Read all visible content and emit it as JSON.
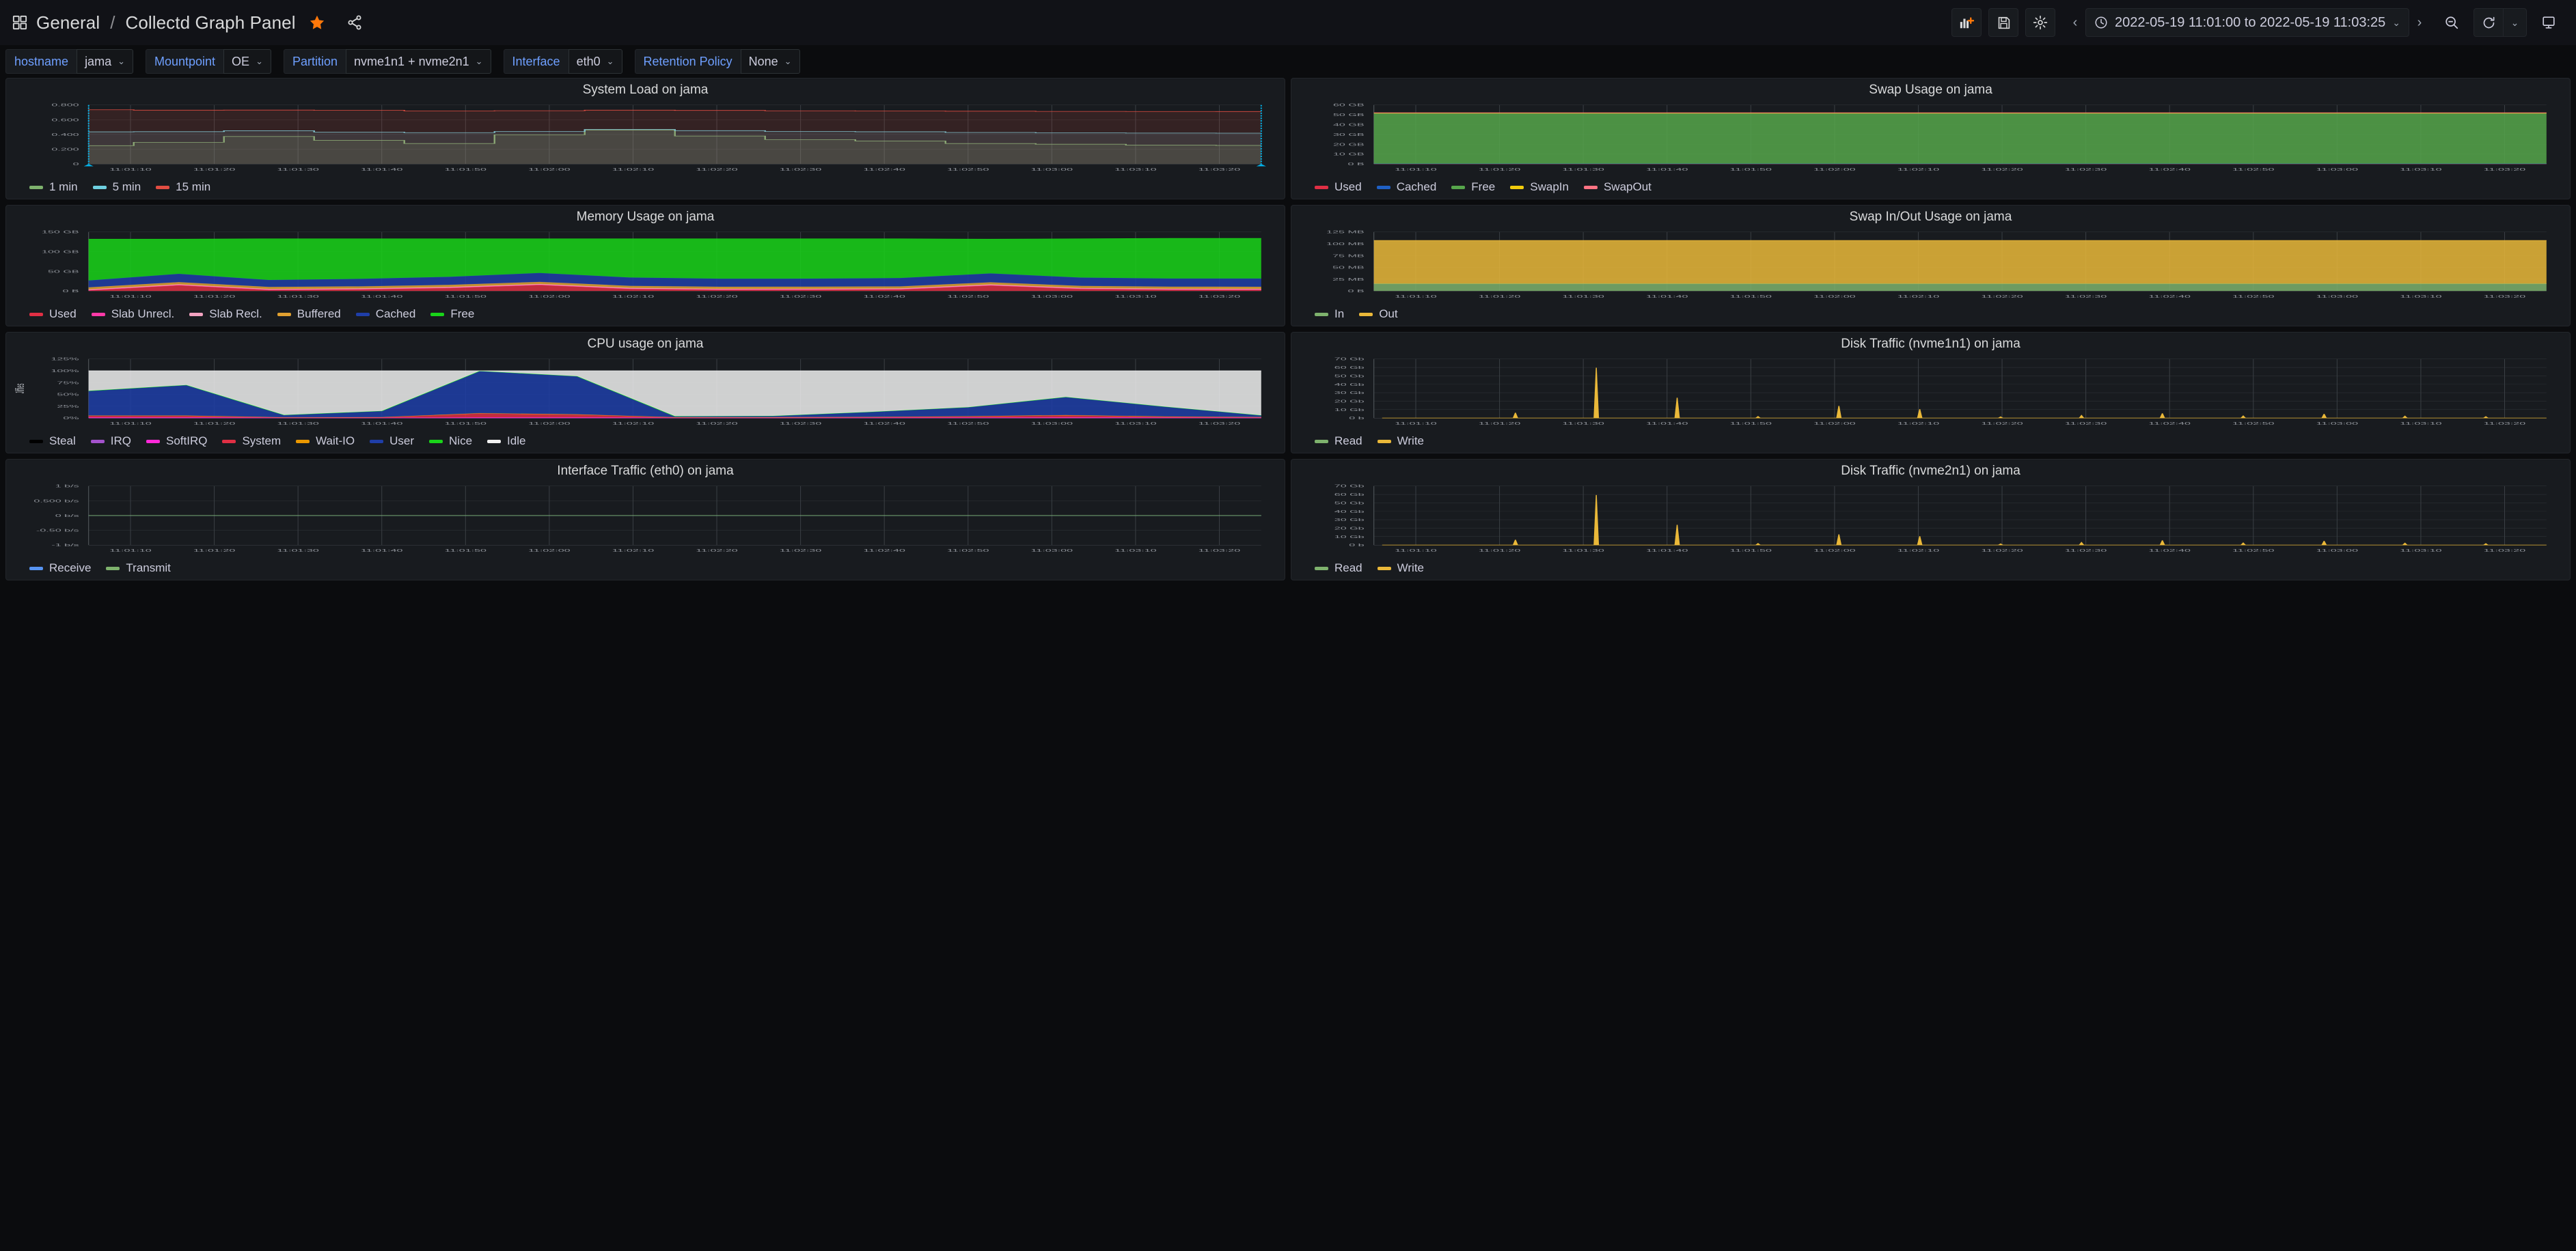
{
  "header": {
    "folder": "General",
    "separator": "/",
    "dashboard_title": "Collectd Graph Panel",
    "grid_icon": "dashboard-grid-icon",
    "star_icon": "star-icon",
    "share_icon": "share-icon",
    "star_color": "#ff780a"
  },
  "toolbar": {
    "add_panel_label": "Add panel",
    "save_label": "Save dashboard",
    "settings_label": "Dashboard settings",
    "prev_label": "Move time range back",
    "next_label": "Move time range forward",
    "time_range": "2022-05-19 11:01:00 to 2022-05-19 11:03:25",
    "zoom_out_label": "Zoom out time range",
    "refresh_label": "Refresh dashboard",
    "refresh_interval": "",
    "tv_label": "Cycle view mode"
  },
  "variables": [
    {
      "label": "hostname",
      "value": "jama"
    },
    {
      "label": "Mountpoint",
      "value": "OE"
    },
    {
      "label": "Partition",
      "value": "nvme1n1 + nvme2n1"
    },
    {
      "label": "Interface",
      "value": "eth0"
    },
    {
      "label": "Retention Policy",
      "value": "None"
    }
  ],
  "colors": {
    "page_bg": "#0b0c0e",
    "panel_bg": "#181b1f",
    "panel_border": "#23262b",
    "text": "#ccccdc",
    "variable_label": "#6e9fff",
    "annotation": "#00b6ef",
    "grid": "#3a3f44"
  },
  "chart_data": [
    {
      "id": "system-load",
      "type": "line",
      "title": "System Load on jama",
      "ylabel": "",
      "xlabel": "",
      "ylim": [
        0,
        0.8
      ],
      "yticks": [
        0,
        0.2,
        0.4,
        0.6,
        0.8
      ],
      "ytick_labels": [
        "0",
        "0.200",
        "0.400",
        "0.600",
        "0.800"
      ],
      "x": [
        "11:01:10",
        "11:01:20",
        "11:01:30",
        "11:01:40",
        "11:01:50",
        "11:02:00",
        "11:02:10",
        "11:02:20",
        "11:02:30",
        "11:02:40",
        "11:02:50",
        "11:03:00",
        "11:03:10",
        "11:03:20"
      ],
      "grid": true,
      "legend_position": "bottom",
      "annotations": [
        {
          "x": "11:01:10",
          "color": "#00b6ef"
        },
        {
          "x": "11:03:20",
          "color": "#00b6ef"
        }
      ],
      "series": [
        {
          "name": "1 min",
          "color": "#7eb26d",
          "values": [
            0.248,
            0.294,
            0.373,
            0.32,
            0.277,
            0.396,
            0.46,
            0.379,
            0.331,
            0.312,
            0.277,
            0.268,
            0.255,
            0.252
          ]
        },
        {
          "name": "5 min",
          "color": "#6ed0e0",
          "values": [
            0.436,
            0.438,
            0.451,
            0.433,
            0.425,
            0.441,
            0.468,
            0.452,
            0.441,
            0.437,
            0.427,
            0.421,
            0.419,
            0.418
          ]
        },
        {
          "name": "15 min",
          "color": "#e24d42",
          "values": [
            0.735,
            0.73,
            0.731,
            0.728,
            0.719,
            0.722,
            0.73,
            0.726,
            0.721,
            0.719,
            0.716,
            0.713,
            0.712,
            0.711
          ]
        }
      ]
    },
    {
      "id": "swap-usage",
      "type": "area",
      "title": "Swap Usage on jama",
      "ylabel": "",
      "xlabel": "",
      "ylim": [
        0,
        60
      ],
      "yunit": "GB",
      "yticks": [
        0,
        10,
        20,
        30,
        40,
        50,
        60
      ],
      "ytick_labels": [
        "0 B",
        "10 GB",
        "20 GB",
        "30 GB",
        "40 GB",
        "50 GB",
        "60 GB"
      ],
      "x": [
        "11:01:10",
        "11:01:20",
        "11:01:30",
        "11:01:40",
        "11:01:50",
        "11:02:00",
        "11:02:10",
        "11:02:20",
        "11:02:30",
        "11:02:40",
        "11:02:50",
        "11:03:00",
        "11:03:10",
        "11:03:20"
      ],
      "grid": true,
      "legend_position": "bottom",
      "series": [
        {
          "name": "Used",
          "color": "#e02f44",
          "values": [
            0.2,
            0.2,
            0.2,
            0.2,
            0.2,
            0.2,
            0.2,
            0.2,
            0.2,
            0.2,
            0.2,
            0.2,
            0.2,
            0.2
          ]
        },
        {
          "name": "Cached",
          "color": "#1f60c4",
          "values": [
            0.1,
            0.1,
            0.1,
            0.1,
            0.1,
            0.1,
            0.1,
            0.1,
            0.1,
            0.1,
            0.1,
            0.1,
            0.1,
            0.1
          ]
        },
        {
          "name": "Free",
          "color": "#56a64b",
          "values": [
            51.4,
            51.4,
            51.4,
            51.4,
            51.4,
            51.4,
            51.4,
            51.4,
            51.4,
            51.4,
            51.4,
            51.4,
            51.4,
            51.4
          ]
        },
        {
          "name": "SwapIn",
          "color": "#f2cc0c",
          "values": [
            0,
            0,
            0,
            0,
            0,
            0,
            0,
            0,
            0,
            0,
            0,
            0,
            0,
            0
          ]
        },
        {
          "name": "SwapOut",
          "color": "#ff7383",
          "values": [
            0.4,
            0.4,
            0.4,
            0.4,
            0.4,
            0.4,
            0.4,
            0.4,
            0.4,
            0.4,
            0.4,
            0.4,
            0.4,
            0.4
          ]
        }
      ]
    },
    {
      "id": "memory-usage",
      "type": "area",
      "title": "Memory Usage on jama",
      "ylabel": "",
      "xlabel": "",
      "ylim": [
        0,
        150
      ],
      "yunit": "GB",
      "yticks": [
        0,
        50,
        100,
        150
      ],
      "ytick_labels": [
        "0 B",
        "50 GB",
        "100 GB",
        "150 GB"
      ],
      "x": [
        "11:01:10",
        "11:01:20",
        "11:01:30",
        "11:01:40",
        "11:01:50",
        "11:02:00",
        "11:02:10",
        "11:02:20",
        "11:02:30",
        "11:02:40",
        "11:02:50",
        "11:03:00",
        "11:03:10",
        "11:03:20"
      ],
      "grid": true,
      "legend_position": "bottom",
      "series": [
        {
          "name": "Used",
          "color": "#e02f44",
          "values": [
            1.5,
            14.5,
            2.6,
            4.0,
            7.7,
            15.2,
            5.3,
            3.1,
            3.3,
            4.0,
            14.0,
            5.2,
            3.3,
            3.0
          ]
        },
        {
          "name": "Slab Unrecl.",
          "color": "#ff3aa8",
          "values": [
            0.8,
            0.8,
            0.8,
            0.8,
            0.8,
            0.8,
            0.8,
            0.8,
            0.8,
            0.8,
            0.8,
            0.8,
            0.8,
            0.8
          ]
        },
        {
          "name": "Slab Recl.",
          "color": "#f2a2c0",
          "values": [
            1.4,
            1.5,
            1.4,
            1.4,
            1.4,
            1.5,
            1.4,
            1.4,
            1.4,
            1.4,
            1.6,
            1.4,
            1.4,
            1.4
          ]
        },
        {
          "name": "Buffered",
          "color": "#e0a030",
          "values": [
            5.4,
            5.5,
            5.4,
            5.4,
            5.4,
            5.5,
            5.4,
            5.4,
            5.4,
            5.4,
            5.5,
            5.4,
            5.4,
            5.4
          ]
        },
        {
          "name": "Cached",
          "color": "#1f3ea8",
          "values": [
            17.5,
            21.3,
            17.8,
            19.2,
            20.8,
            22.8,
            21.4,
            20.5,
            20.5,
            21.4,
            22.7,
            21.2,
            20.8,
            21.0
          ]
        },
        {
          "name": "Free",
          "color": "#19d419",
          "values": [
            105.0,
            88.0,
            104.6,
            101.8,
            96.5,
            86.8,
            98.3,
            101.4,
            101.2,
            99.6,
            87.0,
            98.6,
            101.9,
            102.0
          ]
        }
      ]
    },
    {
      "id": "swap-in-out",
      "type": "area",
      "title": "Swap In/Out Usage on jama",
      "ylabel": "",
      "xlabel": "",
      "ylim": [
        0,
        125
      ],
      "yunit": "MB",
      "yticks": [
        0,
        25,
        50,
        75,
        100,
        125
      ],
      "ytick_labels": [
        "0 B",
        "25 MB",
        "50 MB",
        "75 MB",
        "100 MB",
        "125 MB"
      ],
      "x": [
        "11:01:10",
        "11:01:20",
        "11:01:30",
        "11:01:40",
        "11:01:50",
        "11:02:00",
        "11:02:10",
        "11:02:20",
        "11:02:30",
        "11:02:40",
        "11:02:50",
        "11:03:00",
        "11:03:10",
        "11:03:20"
      ],
      "grid": true,
      "legend_position": "bottom",
      "series": [
        {
          "name": "In",
          "color": "#7eb26d",
          "values": [
            15.5,
            15.5,
            15.5,
            15.5,
            15.5,
            15.5,
            15.5,
            15.5,
            15.5,
            15.5,
            15.5,
            15.5,
            15.5,
            15.5
          ]
        },
        {
          "name": "Out",
          "color": "#eab839",
          "values": [
            91.5,
            91.5,
            91.5,
            91.5,
            91.5,
            91.5,
            91.5,
            91.5,
            91.5,
            91.5,
            91.5,
            91.5,
            91.5,
            91.5
          ]
        }
      ]
    },
    {
      "id": "cpu-usage",
      "type": "area",
      "title": "CPU usage on jama",
      "ylabel": "Jiffies",
      "xlabel": "",
      "ylim": [
        0,
        125
      ],
      "yunit": "%",
      "yticks": [
        0,
        25,
        50,
        75,
        100,
        125
      ],
      "ytick_labels": [
        "0%",
        "25%",
        "50%",
        "75%",
        "100%",
        "125%"
      ],
      "x": [
        "11:01:20",
        "11:01:30",
        "11:01:40",
        "11:01:50",
        "11:02:00",
        "11:02:10",
        "11:02:20",
        "11:02:30",
        "11:02:40",
        "11:02:50",
        "11:03:00",
        "11:03:10",
        "11:03:20"
      ],
      "grid": true,
      "legend_position": "bottom",
      "series": [
        {
          "name": "Steal",
          "color": "#000000",
          "values": [
            0,
            0,
            0,
            0,
            0,
            0,
            0,
            0,
            0,
            0,
            0,
            0,
            0
          ]
        },
        {
          "name": "IRQ",
          "color": "#a352cc",
          "values": [
            0,
            0,
            0,
            0,
            0,
            0,
            0,
            0,
            0,
            0,
            0,
            0,
            0
          ]
        },
        {
          "name": "SoftIRQ",
          "color": "#ff29d8",
          "values": [
            1.2,
            1.2,
            0.6,
            0.6,
            1.2,
            1.2,
            0.6,
            0.6,
            0.7,
            0.9,
            1.2,
            0.9,
            0.7
          ]
        },
        {
          "name": "System",
          "color": "#e02f44",
          "values": [
            3.4,
            3.4,
            0.7,
            1.0,
            8.4,
            6.0,
            0.7,
            0.8,
            1.2,
            2.4,
            4.4,
            2.0,
            1.0
          ]
        },
        {
          "name": "Wait-IO",
          "color": "#eb9800",
          "values": [
            0.5,
            0.4,
            0.2,
            0.2,
            0.6,
            0.5,
            0.3,
            0.3,
            0.3,
            0.4,
            0.5,
            0.3,
            0.3
          ]
        },
        {
          "name": "User",
          "color": "#1f3ea8",
          "values": [
            52.0,
            64.5,
            4.7,
            12.9,
            89.0,
            80.5,
            2.0,
            2.5,
            10.5,
            19.0,
            38.0,
            21.0,
            3.5
          ]
        },
        {
          "name": "Nice",
          "color": "#19d419",
          "values": [
            0.5,
            0.5,
            0.3,
            0.3,
            0.5,
            0.5,
            0.3,
            0.3,
            0.3,
            0.3,
            0.5,
            0.3,
            0.3
          ]
        },
        {
          "name": "Idle",
          "color": "#f0f0f0",
          "values": [
            42.4,
            30.0,
            93.5,
            85.0,
            0.3,
            11.3,
            96.1,
            95.5,
            87.0,
            77.0,
            55.4,
            75.5,
            94.2
          ]
        }
      ]
    },
    {
      "id": "disk-traffic-nvme1n1",
      "type": "line",
      "title": "Disk Traffic (nvme1n1) on jama",
      "ylabel": "",
      "xlabel": "",
      "ylim": [
        0,
        70
      ],
      "yunit": "Gb",
      "yticks": [
        0,
        10,
        20,
        30,
        40,
        50,
        60,
        70
      ],
      "ytick_labels": [
        "0 b",
        "10 Gb",
        "20 Gb",
        "30 Gb",
        "40 Gb",
        "50 Gb",
        "60 Gb",
        "70 Gb"
      ],
      "grid": true,
      "legend_position": "bottom",
      "spikes": [
        {
          "t": 17.5,
          "v": 6.3
        },
        {
          "t": 27.5,
          "v": 59.6
        },
        {
          "t": 37.5,
          "v": 24.1
        },
        {
          "t": 47.5,
          "v": 2.0
        },
        {
          "t": 57.5,
          "v": 14.4
        },
        {
          "t": 67.5,
          "v": 10.5
        },
        {
          "t": 77.5,
          "v": 1.5
        },
        {
          "t": 87.5,
          "v": 3.2
        },
        {
          "t": 97.5,
          "v": 5.5
        },
        {
          "t": 107.5,
          "v": 2.6
        },
        {
          "t": 117.5,
          "v": 4.8
        },
        {
          "t": 127.5,
          "v": 2.4
        },
        {
          "t": 137.5,
          "v": 1.8
        }
      ],
      "series": [
        {
          "name": "Read",
          "color": "#7eb26d",
          "values": []
        },
        {
          "name": "Write",
          "color": "#eab839",
          "values": []
        }
      ]
    },
    {
      "id": "interface-traffic",
      "type": "line",
      "title": "Interface Traffic (eth0) on jama",
      "ylabel": "",
      "xlabel": "",
      "ylim": [
        -1,
        1
      ],
      "yunit": "b/s",
      "yticks": [
        -1,
        -0.5,
        0,
        0.5,
        1
      ],
      "ytick_labels": [
        "-1 b/s",
        "-0.50 b/s",
        "0 b/s",
        "0.500 b/s",
        "1 b/s"
      ],
      "x": [
        "11:01:10",
        "11:01:20",
        "11:01:30",
        "11:01:40",
        "11:01:50",
        "11:02:00",
        "11:02:10",
        "11:02:20",
        "11:02:30",
        "11:02:40",
        "11:02:50",
        "11:03:00",
        "11:03:10",
        "11:03:20"
      ],
      "grid": true,
      "legend_position": "bottom",
      "series": [
        {
          "name": "Receive",
          "color": "#5794f2",
          "values": [
            0,
            0,
            0,
            0,
            0,
            0,
            0,
            0,
            0,
            0,
            0,
            0,
            0,
            0
          ]
        },
        {
          "name": "Transmit",
          "color": "#7eb26d",
          "values": [
            0,
            0,
            0,
            0,
            0,
            0,
            0,
            0,
            0,
            0,
            0,
            0,
            0,
            0
          ]
        }
      ]
    },
    {
      "id": "disk-traffic-nvme2n1",
      "type": "line",
      "title": "Disk Traffic (nvme2n1) on jama",
      "ylabel": "",
      "xlabel": "",
      "ylim": [
        0,
        70
      ],
      "yunit": "Gb",
      "yticks": [
        0,
        10,
        20,
        30,
        40,
        50,
        60,
        70
      ],
      "ytick_labels": [
        "0 b",
        "10 Gb",
        "20 Gb",
        "30 Gb",
        "40 Gb",
        "50 Gb",
        "60 Gb",
        "70 Gb"
      ],
      "grid": true,
      "legend_position": "bottom",
      "spikes": [
        {
          "t": 17.5,
          "v": 6.3
        },
        {
          "t": 27.5,
          "v": 59.3
        },
        {
          "t": 37.5,
          "v": 24.0
        },
        {
          "t": 47.5,
          "v": 2.0
        },
        {
          "t": 57.5,
          "v": 12.6
        },
        {
          "t": 67.5,
          "v": 10.5
        },
        {
          "t": 77.5,
          "v": 1.5
        },
        {
          "t": 87.5,
          "v": 3.2
        },
        {
          "t": 97.5,
          "v": 5.5
        },
        {
          "t": 107.5,
          "v": 2.6
        },
        {
          "t": 117.5,
          "v": 4.8
        },
        {
          "t": 127.5,
          "v": 2.4
        },
        {
          "t": 137.5,
          "v": 1.8
        }
      ],
      "series": [
        {
          "name": "Read",
          "color": "#7eb26d",
          "values": []
        },
        {
          "name": "Write",
          "color": "#eab839",
          "values": []
        }
      ]
    }
  ],
  "xaxis_labels": [
    "11:01:10",
    "11:01:20",
    "11:01:30",
    "11:01:40",
    "11:01:50",
    "11:02:00",
    "11:02:10",
    "11:02:20",
    "11:02:30",
    "11:02:40",
    "11:02:50",
    "11:03:00",
    "11:03:10",
    "11:03:20"
  ]
}
